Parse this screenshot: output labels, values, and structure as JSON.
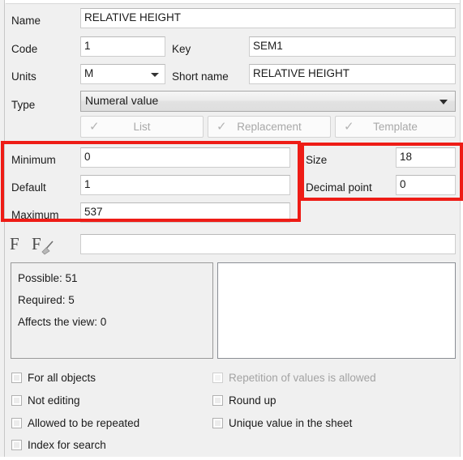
{
  "form": {
    "name": {
      "label": "Name",
      "value": "RELATIVE HEIGHT"
    },
    "code": {
      "label": "Code",
      "value": "1"
    },
    "key": {
      "label": "Key",
      "value": "SEM1"
    },
    "units": {
      "label": "Units",
      "value": "M"
    },
    "short_name": {
      "label": "Short name",
      "value": "RELATIVE HEIGHT"
    },
    "type": {
      "label": "Type",
      "value": "Numeral value"
    }
  },
  "buttons": {
    "list": "List",
    "replacement": "Replacement",
    "template": "Template",
    "check_glyph": "✓"
  },
  "range": {
    "minimum": {
      "label": "Minimum",
      "value": "0"
    },
    "default": {
      "label": "Default",
      "value": "1"
    },
    "maximum": {
      "label": "Maximum",
      "value": "537"
    }
  },
  "numeric": {
    "size": {
      "label": "Size",
      "value": "18"
    },
    "decimal_point": {
      "label": "Decimal point",
      "value": "0"
    }
  },
  "formula_toolbar": {
    "formula_icon": "F",
    "clear_formula_icon": "F",
    "formula_value": "",
    "formula_placeholder": ""
  },
  "stats": {
    "possible": "Possible: 51",
    "required": "Required: 5",
    "affects_view": "Affects the view: 0"
  },
  "notes": {
    "value": ""
  },
  "checkboxes_left": [
    {
      "label": "For all objects",
      "checked": false,
      "disabled": false
    },
    {
      "label": "Not editing",
      "checked": false,
      "disabled": false
    },
    {
      "label": "Allowed to be repeated",
      "checked": false,
      "disabled": false
    },
    {
      "label": "Index for search",
      "checked": false,
      "disabled": false
    }
  ],
  "checkboxes_right": [
    {
      "label": "Repetition of values is allowed",
      "checked": false,
      "disabled": true
    },
    {
      "label": "Round up",
      "checked": false,
      "disabled": false
    },
    {
      "label": "Unique value in the sheet",
      "checked": false,
      "disabled": false
    }
  ],
  "highlights": {
    "range_color": "#ee1c16",
    "numeric_color": "#ee1c16"
  }
}
